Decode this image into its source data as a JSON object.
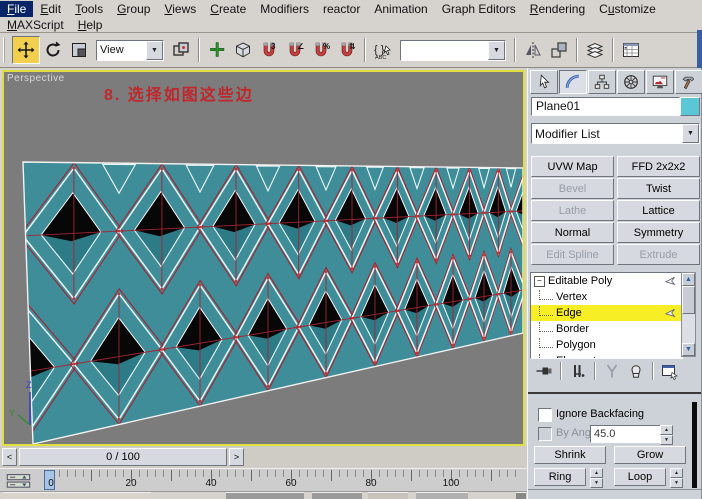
{
  "menu": {
    "row1": [
      {
        "id": "file",
        "label": "File",
        "u": 0,
        "active": true
      },
      {
        "id": "edit",
        "label": "Edit",
        "u": 0
      },
      {
        "id": "tools",
        "label": "Tools",
        "u": 0
      },
      {
        "id": "group",
        "label": "Group",
        "u": 0
      },
      {
        "id": "views",
        "label": "Views",
        "u": 0
      },
      {
        "id": "create",
        "label": "Create",
        "u": 0
      },
      {
        "id": "modifiers",
        "label": "Modifiers",
        "u": -1
      },
      {
        "id": "reactor",
        "label": "reactor",
        "u": -1
      },
      {
        "id": "animation",
        "label": "Animation",
        "u": -1
      },
      {
        "id": "graph-editors",
        "label": "Graph Editors",
        "u": -1
      },
      {
        "id": "rendering",
        "label": "Rendering",
        "u": 0
      },
      {
        "id": "customize",
        "label": "Customize",
        "u": 1
      }
    ],
    "row2": [
      {
        "id": "maxscript",
        "label": "MAXScript",
        "u": 0
      },
      {
        "id": "help",
        "label": "Help",
        "u": 0
      }
    ]
  },
  "toolbar": {
    "coord_dropdown": "View",
    "named_sets_value": ""
  },
  "viewport": {
    "label": "Perspective",
    "annotation": "8. 选择如图这些边",
    "axis": {
      "z": "Z",
      "y": "Y"
    }
  },
  "panel": {
    "tabs": [
      {
        "id": "create"
      },
      {
        "id": "modify",
        "active": true
      },
      {
        "id": "hierarchy"
      },
      {
        "id": "motion"
      },
      {
        "id": "display"
      },
      {
        "id": "utilities"
      }
    ],
    "object_name": "Plane01",
    "modifier_list_label": "Modifier List",
    "modifier_buttons": [
      {
        "label": "UVW Map",
        "enabled": true
      },
      {
        "label": "FFD 2x2x2",
        "enabled": true
      },
      {
        "label": "Bevel",
        "enabled": false
      },
      {
        "label": "Twist",
        "enabled": true
      },
      {
        "label": "Lathe",
        "enabled": false
      },
      {
        "label": "Lattice",
        "enabled": true
      },
      {
        "label": "Normal",
        "enabled": true
      },
      {
        "label": "Symmetry",
        "enabled": true
      },
      {
        "label": "Edit Spline",
        "enabled": false
      },
      {
        "label": "Extrude",
        "enabled": false
      }
    ],
    "stack": [
      {
        "label": "Editable Poly",
        "root": true,
        "arrow": true
      },
      {
        "label": "Vertex",
        "child": true
      },
      {
        "label": "Edge",
        "child": true,
        "selected": true,
        "arrow": true
      },
      {
        "label": "Border",
        "child": true
      },
      {
        "label": "Polygon",
        "child": true
      },
      {
        "label": "Element",
        "child": true
      }
    ],
    "selection": {
      "ignore_backfacing": "Ignore Backfacing",
      "by_angle": "By Angle:",
      "angle_value": "45.0",
      "shrink": "Shrink",
      "grow": "Grow",
      "ring": "Ring",
      "loop": "Loop"
    }
  },
  "timeline": {
    "prev": "<",
    "value": "0 / 100",
    "next": ">"
  },
  "trackbar": {
    "labels": [
      "0",
      "20",
      "40",
      "60",
      "80",
      "100"
    ]
  },
  "colors": {
    "viewport_bg": "#7C7C7C",
    "viewport_border": "#DFDF3F",
    "mesh_teal": "#3F8D99",
    "mesh_inner": "#2E7B88",
    "mesh_edge": "#ECF7F7",
    "mesh_red": "#A22433",
    "mesh_vertex_red": "#D03030",
    "mesh_hole": "#070707",
    "swatch": "#5BC6D6",
    "stack_selected": "#F8EE26",
    "menu_active": "#0A246A"
  }
}
